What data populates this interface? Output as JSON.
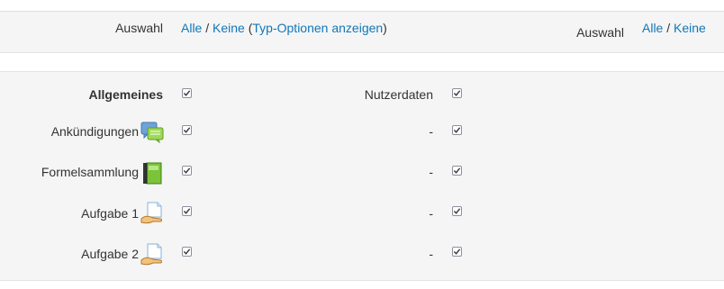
{
  "header": {
    "left": {
      "label": "Auswahl",
      "all": "Alle",
      "separator": "/",
      "none": "Keine",
      "open_paren": "(",
      "type_options": "Typ-Optionen anzeigen",
      "close_paren": ")"
    },
    "right": {
      "label": "Auswahl",
      "all": "Alle",
      "separator": "/",
      "none": "Keine"
    }
  },
  "rows": [
    {
      "label": "Allgemeines",
      "icon": null,
      "checked": true,
      "userdata": "Nutzerdaten",
      "userdata_checked": true
    },
    {
      "label": "Ankündigungen",
      "icon": "forum-icon",
      "checked": true,
      "userdata": "-",
      "userdata_checked": true
    },
    {
      "label": "Formelsammlung",
      "icon": "book-icon",
      "checked": true,
      "userdata": "-",
      "userdata_checked": true
    },
    {
      "label": "Aufgabe 1",
      "icon": "assignment-icon",
      "checked": true,
      "userdata": "-",
      "userdata_checked": true
    },
    {
      "label": "Aufgabe 2",
      "icon": "assignment-icon",
      "checked": true,
      "userdata": "-",
      "userdata_checked": true
    }
  ],
  "colors": {
    "link": "#1177b8",
    "band": "#f5f5f5",
    "text": "#333333"
  }
}
